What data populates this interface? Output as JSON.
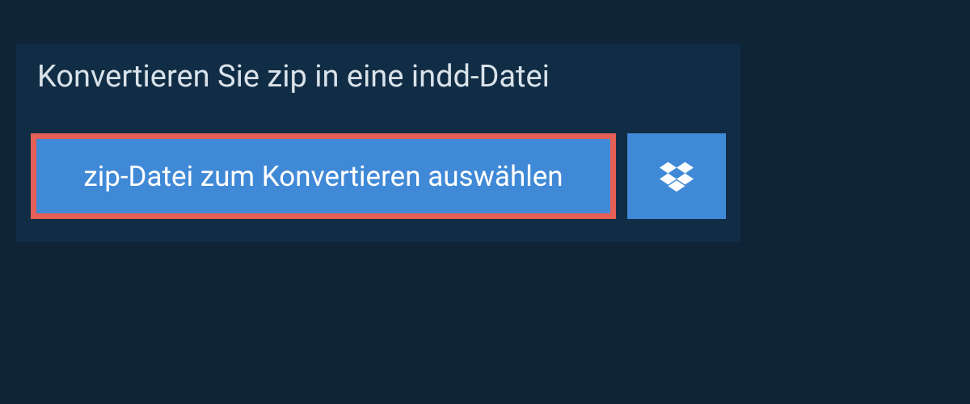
{
  "heading": "Konvertieren Sie zip in eine indd-Datei",
  "buttons": {
    "select_file_label": "zip-Datei zum Konvertieren auswählen"
  },
  "colors": {
    "background": "#0f2437",
    "panel": "#112d45",
    "button": "#4089d6",
    "highlight_border": "#e45f56",
    "text_light": "#d9e2ea",
    "text_white": "#ffffff"
  }
}
